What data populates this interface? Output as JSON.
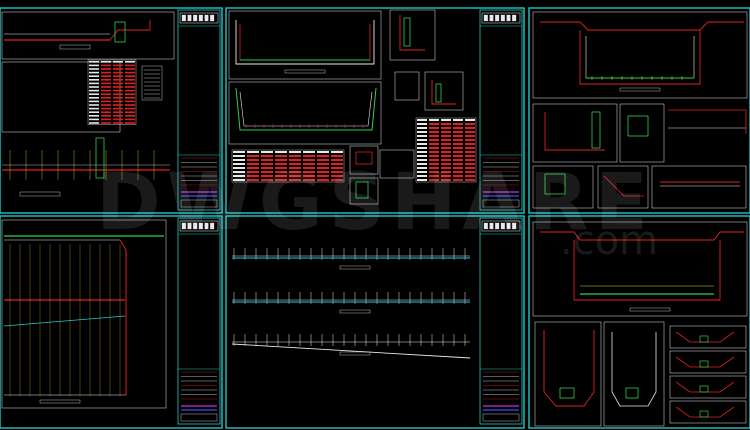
{
  "watermark": {
    "brand": "DWGSHARE",
    "suffix": ".com"
  },
  "colors": {
    "frame": "#22c6c6",
    "panel": "#000000",
    "red": "#e02020",
    "white": "#e8e8e8",
    "green": "#2fd04a",
    "yellow": "#e6d02a",
    "magenta": "#d030d0",
    "blue": "#3a4cff",
    "cyan": "#20c8d8"
  },
  "sheets": [
    {
      "id": "sheet-1",
      "kind": "plan-and-table"
    },
    {
      "id": "sheet-2",
      "kind": "sections-and-tables"
    },
    {
      "id": "sheet-3",
      "kind": "section-details"
    },
    {
      "id": "sheet-4",
      "kind": "plan-wall"
    },
    {
      "id": "sheet-5",
      "kind": "elevations"
    },
    {
      "id": "sheet-6",
      "kind": "details-grid"
    }
  ]
}
